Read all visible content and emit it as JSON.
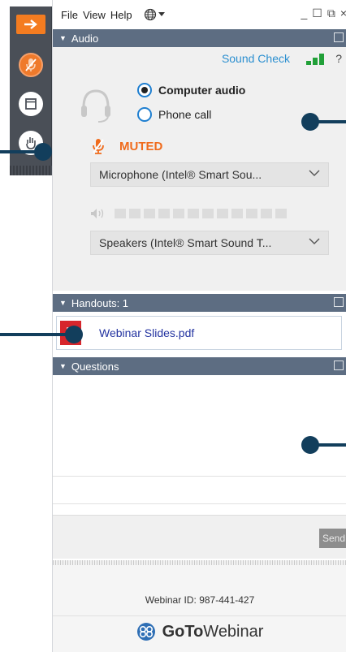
{
  "menu": {
    "file": "File",
    "view": "View",
    "help": "Help"
  },
  "window_controls": {
    "minimize": "_",
    "maximize": "☐",
    "popout": "⧉",
    "close": "×"
  },
  "toolbar": {
    "icons": [
      "arrow-right-icon",
      "microphone-muted-icon",
      "window-icon",
      "raise-hand-icon"
    ],
    "accent": "#f47c20"
  },
  "audio": {
    "header": "Audio",
    "sound_check": "Sound Check",
    "help": "?",
    "options": {
      "computer": "Computer audio",
      "phone": "Phone call"
    },
    "selected": "computer",
    "mute_status": "MUTED",
    "microphone": "Microphone (Intel® Smart Sou...",
    "speakers": "Speakers (Intel® Smart Sound T...",
    "speaker_level_fraction": 0
  },
  "handouts": {
    "header": "Handouts: 1",
    "items": [
      {
        "name": "Webinar Slides.pdf"
      }
    ]
  },
  "questions": {
    "header": "Questions",
    "send": "Send"
  },
  "footer": {
    "webinar_id": "Webinar ID: 987-441-427",
    "logo_bold": "GoTo",
    "logo_regular": "Webinar"
  },
  "colors": {
    "header_bg": "#5d6d82",
    "muted": "#f06b1c",
    "link": "#2333a0",
    "sound_check": "#2b8fd0",
    "callout": "#123e5c"
  }
}
